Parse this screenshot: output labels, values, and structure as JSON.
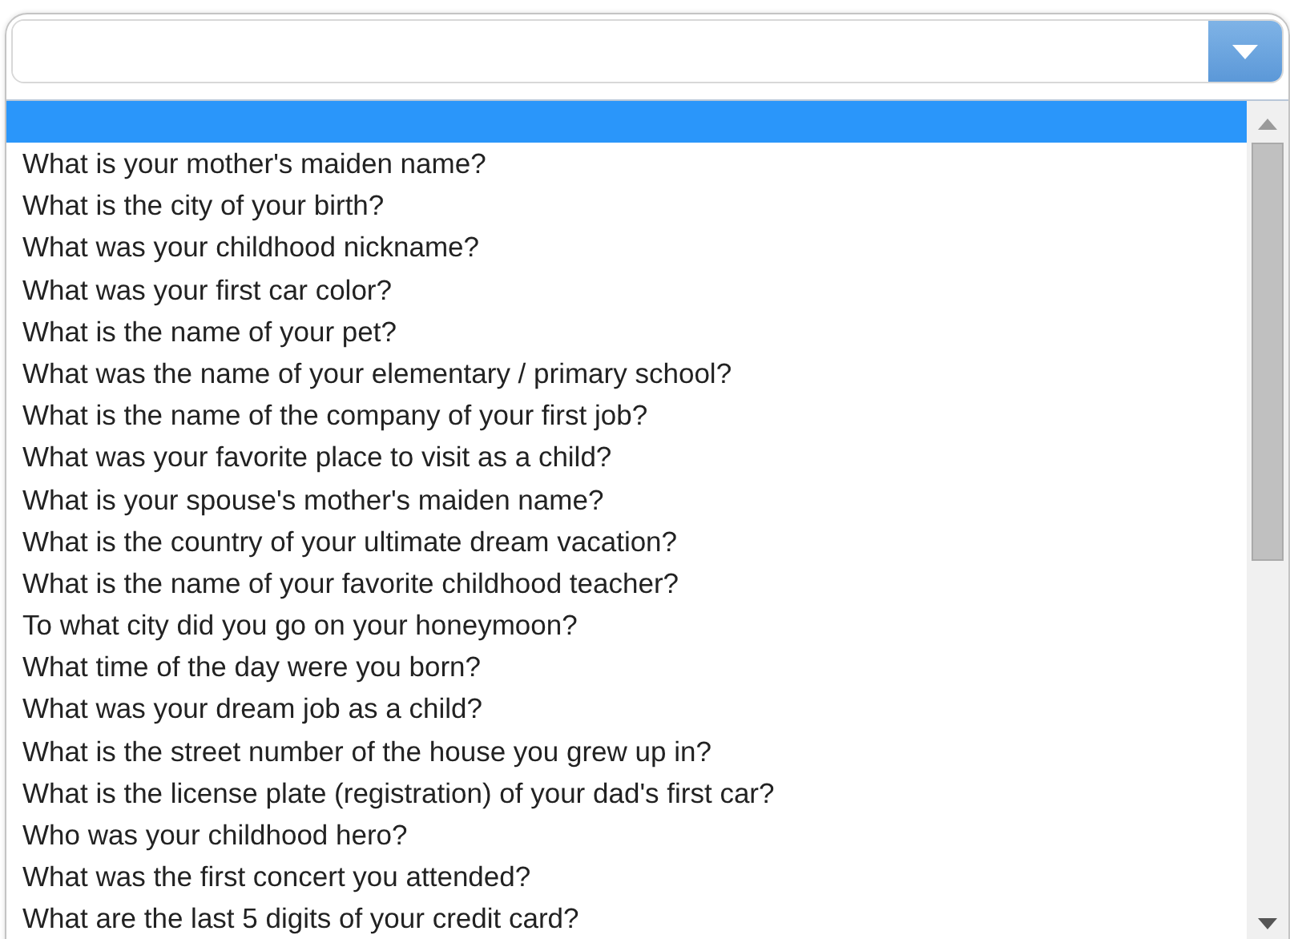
{
  "list": {
    "blank_option": {
      "selected": true
    },
    "options": [
      {
        "label": "What is your mother's maiden name?",
        "selected": false
      },
      {
        "label": "What is the city of your birth?",
        "selected": false
      },
      {
        "label": "What was your childhood nickname?",
        "selected": false
      },
      {
        "label": "What was your first car color?",
        "selected": false
      },
      {
        "label": "What is the name of your pet?",
        "selected": false
      },
      {
        "label": "What was the name of your elementary / primary school?",
        "selected": false
      },
      {
        "label": "What is the name of the company of your first job?",
        "selected": false
      },
      {
        "label": "What was your favorite place to visit as a child?",
        "selected": false
      },
      {
        "label": "What is your spouse's mother's maiden name?",
        "selected": false
      },
      {
        "label": "What is the country of your ultimate dream vacation?",
        "selected": false
      },
      {
        "label": "What is the name of your favorite childhood teacher?",
        "selected": false
      },
      {
        "label": "To what city did you go on your honeymoon?",
        "selected": false
      },
      {
        "label": "What time of the day were you born?",
        "selected": false
      },
      {
        "label": "What was your dream job as a child?",
        "selected": false
      },
      {
        "label": "What is the street number of the house you grew up in?",
        "selected": false
      },
      {
        "label": "What is the license plate (registration) of your dad's first car?",
        "selected": false
      },
      {
        "label": "Who was your childhood hero?",
        "selected": false
      },
      {
        "label": "What was the first concert you attended?",
        "selected": false
      },
      {
        "label": "What are the last 5 digits of your credit card?",
        "selected": false
      }
    ]
  }
}
